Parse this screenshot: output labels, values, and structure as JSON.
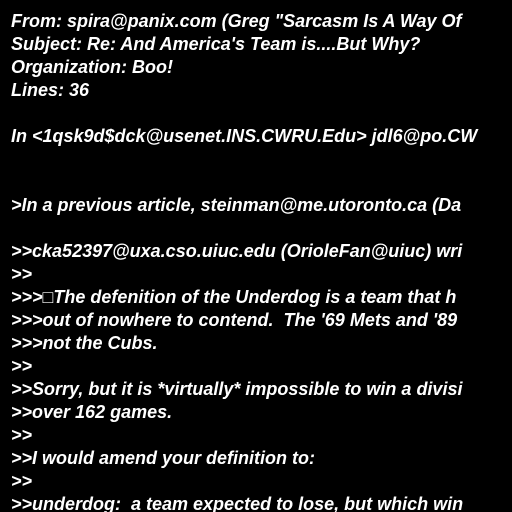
{
  "document": {
    "background_color": "#000000",
    "text_color": "#ffffff",
    "lines": [
      "From: spira@panix.com (Greg \"Sarcasm Is A Way Of",
      "Subject: Re: And America's Team is....But Why?",
      "Organization: Boo!",
      "Lines: 36",
      "",
      "In <1qsk9d$dck@usenet.INS.CWRU.Edu> jdl6@po.CW",
      "",
      "",
      ">In a previous article, steinman@me.utoronto.ca (Da",
      "",
      ">>cka52397@uxa.cso.uiuc.edu (OrioleFan@uiuc) wri",
      ">>",
      ">>>□The defenition of the Underdog is a team that h",
      ">>>out of nowhere to contend.  The '69 Mets and '89",
      ">>>not the Cubs.",
      ">>",
      ">>Sorry, but it is *virtually* impossible to win a divisi",
      ">>over 162 games.",
      ">>",
      ">>I would amend your definition to:",
      ">>",
      ">>underdog:  a team expected to lose, but which win"
    ]
  }
}
